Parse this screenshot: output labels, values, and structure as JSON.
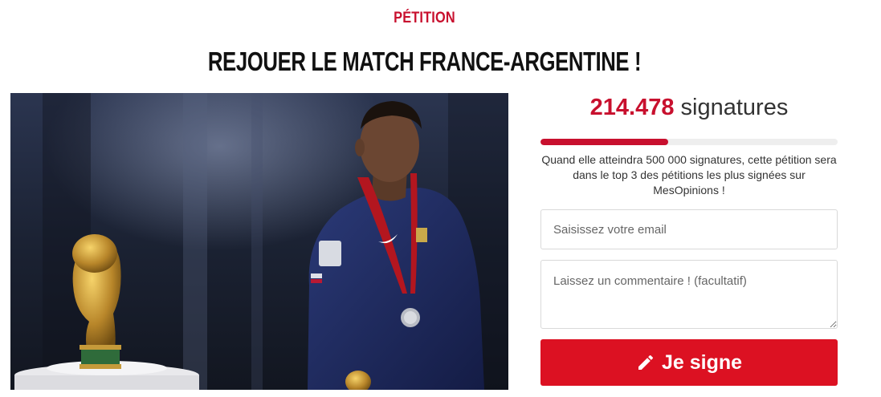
{
  "header": {
    "kicker": "PÉTITION",
    "title": "REJOUER LE MATCH FRANCE-ARGENTINE !"
  },
  "petition": {
    "signature_count": "214.478",
    "signature_word": "signatures",
    "progress_fraction": 0.43,
    "goal_text": "Quand elle atteindra 500 000 signatures, cette pétition sera dans le top 3 des pétitions les plus signées sur MesOpinions !"
  },
  "form": {
    "email_placeholder": "Saisissez votre email",
    "comment_placeholder": "Laissez un commentaire ! (facultatif)",
    "submit_label": "Je signe",
    "submit_icon": "pencil-icon"
  },
  "colors": {
    "accent": "#c8102e",
    "button": "#dc1122"
  }
}
